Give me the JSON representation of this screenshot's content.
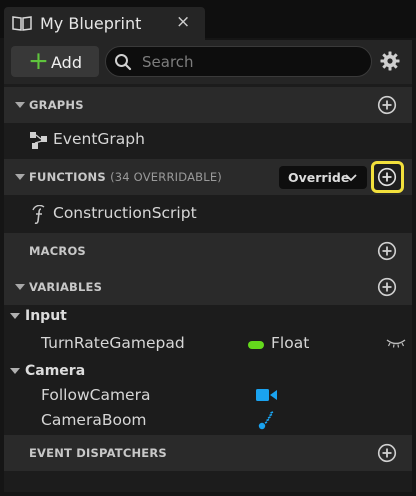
{
  "tab": {
    "title": "My Blueprint",
    "close": "×",
    "icon": "book-icon"
  },
  "toolbar": {
    "add_label": "Add",
    "add_icon": "plus-icon",
    "search_placeholder": "Search",
    "search_value": "",
    "settings_icon": "gear-icon"
  },
  "sections": {
    "graphs": {
      "title": "GRAPHS",
      "items": [
        {
          "label": "EventGraph",
          "icon": "event-graph-icon"
        }
      ]
    },
    "functions": {
      "title": "FUNCTIONS",
      "subtitle": "(34 OVERRIDABLE)",
      "override_label": "Override",
      "items": [
        {
          "label": "ConstructionScript",
          "icon": "function-icon"
        }
      ]
    },
    "macros": {
      "title": "MACROS"
    },
    "variables": {
      "title": "VARIABLES",
      "categories": [
        {
          "label": "Input",
          "items": [
            {
              "name": "TurnRateGamepad",
              "type": "Float",
              "type_color": "#64d91c",
              "visibility_icon": "eye-closed-icon"
            }
          ]
        },
        {
          "label": "Camera",
          "items": [
            {
              "name": "FollowCamera",
              "icon": "camera-component-icon",
              "icon_color": "#1aa3f0"
            },
            {
              "name": "CameraBoom",
              "icon": "spring-arm-icon",
              "icon_color": "#1aa3f0"
            }
          ]
        }
      ]
    },
    "event_dispatchers": {
      "title": "EVENT DISPATCHERS"
    }
  },
  "highlight_color": "#f2e03c"
}
